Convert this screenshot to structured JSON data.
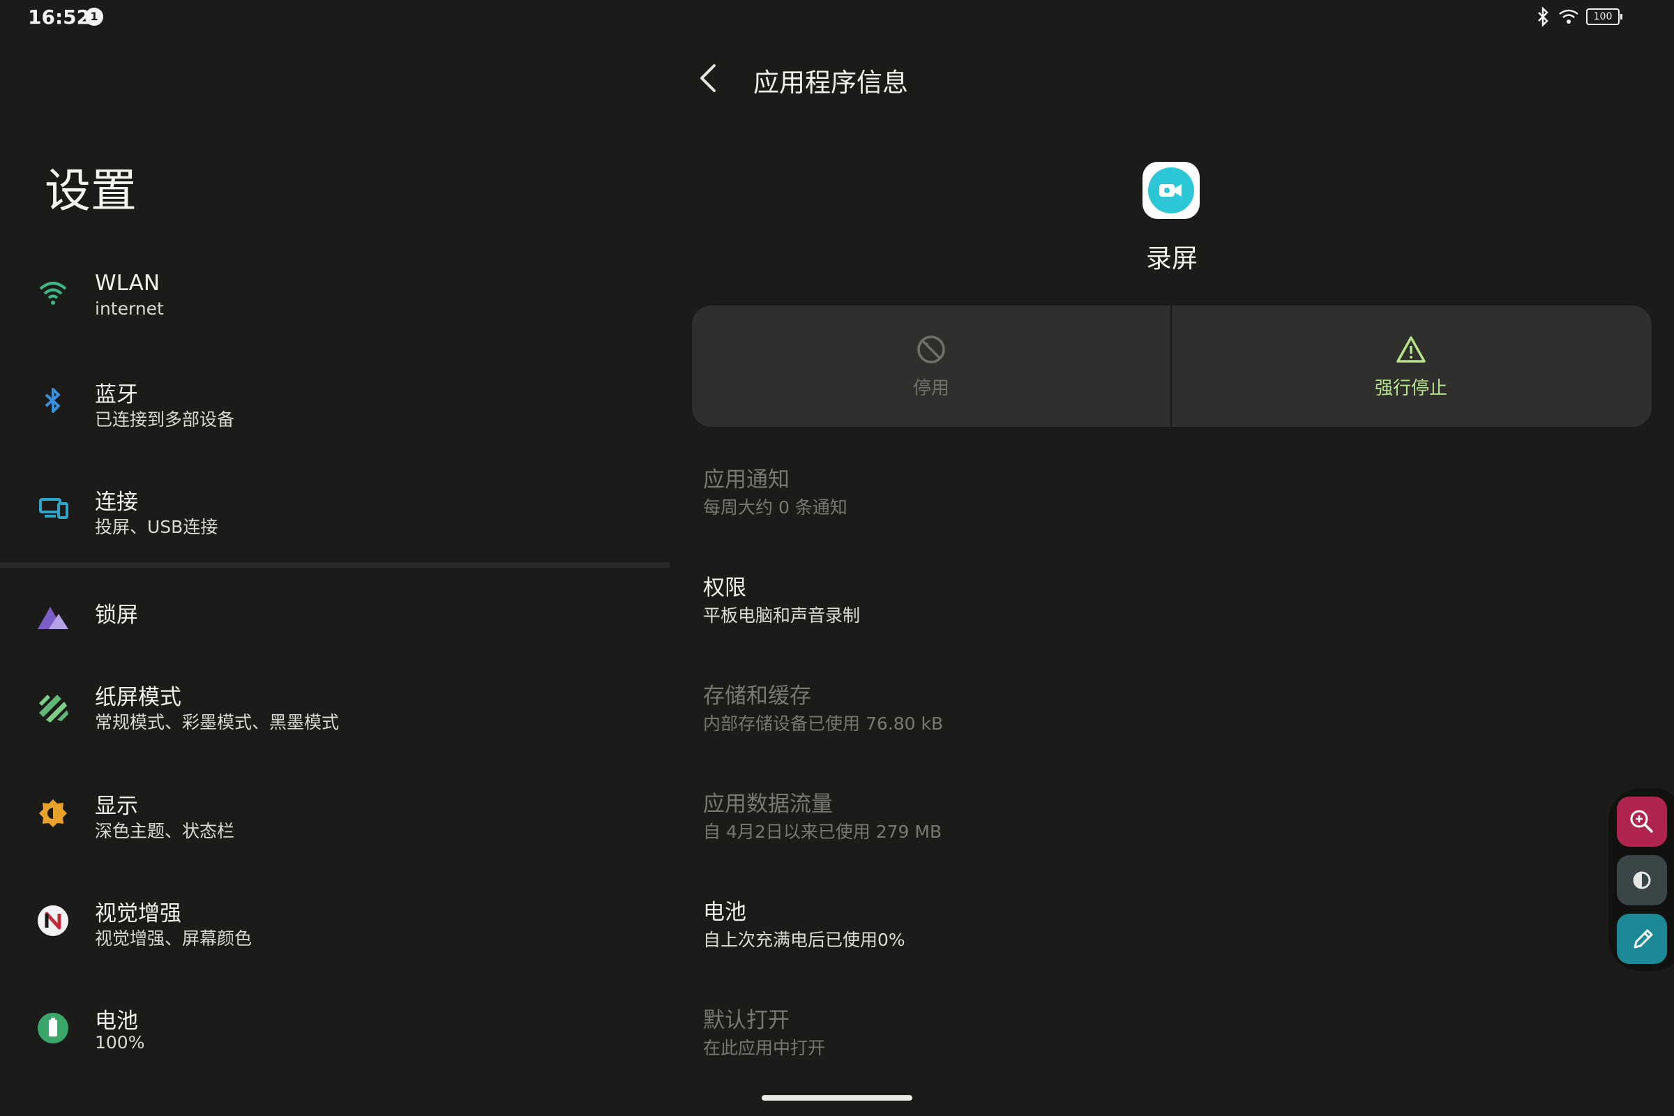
{
  "status_bar": {
    "time": "16:52",
    "notification_count": "1",
    "battery": "100"
  },
  "left": {
    "title": "设置",
    "items": [
      {
        "title": "WLAN",
        "subtitle": "internet",
        "icon": "wifi-icon"
      },
      {
        "title": "蓝牙",
        "subtitle": "已连接到多部设备",
        "icon": "bluetooth-icon"
      },
      {
        "title": "连接",
        "subtitle": "投屏、USB连接",
        "icon": "devices-icon"
      },
      {
        "title": "锁屏",
        "subtitle": "",
        "icon": "lockscreen-mountain-icon"
      },
      {
        "title": "纸屏模式",
        "subtitle": "常规模式、彩墨模式、黑墨模式",
        "icon": "paper-mode-icon"
      },
      {
        "title": "显示",
        "subtitle": "深色主题、状态栏",
        "icon": "brightness-icon"
      },
      {
        "title": "视觉增强",
        "subtitle": "视觉增强、屏幕颜色",
        "icon": "visual-enhance-icon"
      },
      {
        "title": "电池",
        "subtitle": "100%",
        "icon": "battery-icon"
      }
    ]
  },
  "right": {
    "page_title": "应用程序信息",
    "app_name": "录屏",
    "actions": {
      "disable": "停用",
      "force_stop": "强行停止"
    },
    "rows": [
      {
        "title": "应用通知",
        "subtitle": "每周大约 0 条通知",
        "style": "dim"
      },
      {
        "title": "权限",
        "subtitle": "平板电脑和声音录制",
        "style": "bright"
      },
      {
        "title": "存储和缓存",
        "subtitle": "内部存储设备已使用 76.80 kB",
        "style": "dim"
      },
      {
        "title": "应用数据流量",
        "subtitle": "自 4月2日以来已使用 279 MB",
        "style": "dim"
      },
      {
        "title": "电池",
        "subtitle": "自上次充满电后已使用0%",
        "style": "bright"
      },
      {
        "title": "默认打开",
        "subtitle": "在此应用中打开",
        "style": "dim"
      }
    ]
  },
  "colors": {
    "background": "#1b1c1a",
    "force_stop_accent": "#b7e38a",
    "zoom_button": "#b0254f",
    "contrast_button": "#3a4548",
    "pen_button": "#1b8a96"
  }
}
